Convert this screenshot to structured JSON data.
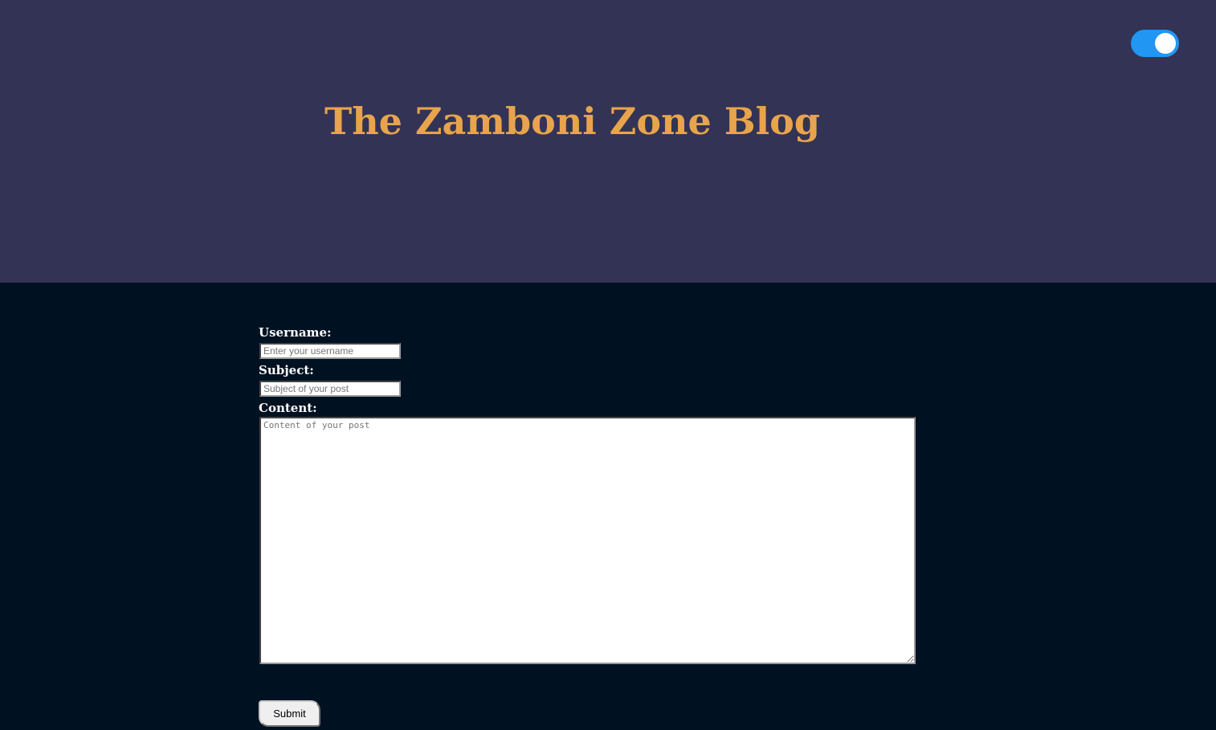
{
  "header": {
    "title": "The Zamboni Zone Blog",
    "theme_toggle": {
      "state": "on",
      "accent_color": "#2196f3"
    },
    "background_color": "#333355",
    "title_color": "#e8a44c"
  },
  "form": {
    "username": {
      "label": "Username:",
      "placeholder": "Enter your username",
      "value": ""
    },
    "subject": {
      "label": "Subject:",
      "placeholder": "Subject of your post",
      "value": ""
    },
    "content": {
      "label": "Content:",
      "placeholder": "Content of your post",
      "value": ""
    },
    "submit_label": "Submit"
  },
  "page_background_color": "#001122"
}
